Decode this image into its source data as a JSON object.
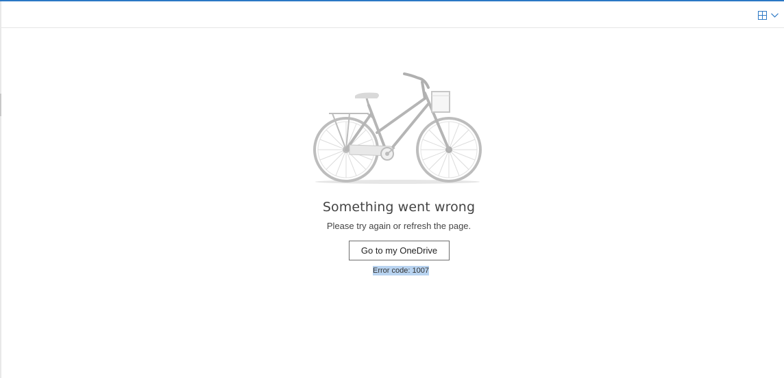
{
  "header": {
    "view_switcher": {
      "icon": "grid-view-icon",
      "dropdown_icon": "chevron-down-icon"
    }
  },
  "colors": {
    "accent": "#2b78c5",
    "selection": "#b8d3f0",
    "illustration": "#bdbdbd"
  },
  "error": {
    "illustration": "bicycle-illustration",
    "title": "Something went wrong",
    "message": "Please try again or refresh the page.",
    "button_label": "Go to my OneDrive",
    "code_text": "Error code: 1007"
  }
}
